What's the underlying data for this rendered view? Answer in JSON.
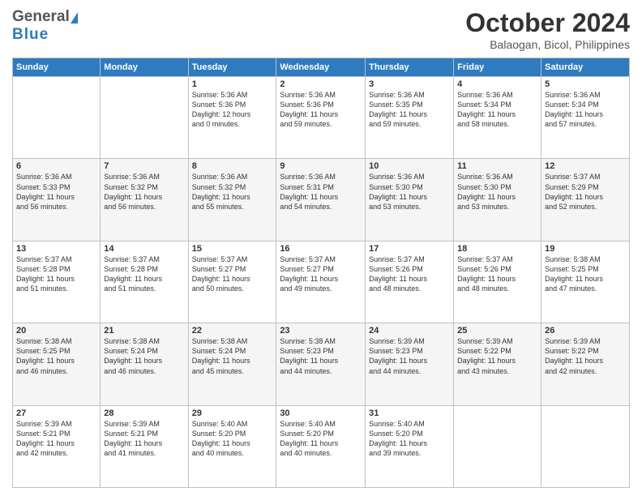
{
  "header": {
    "logo_general": "General",
    "logo_blue": "Blue",
    "month": "October 2024",
    "location": "Balaogan, Bicol, Philippines"
  },
  "days_of_week": [
    "Sunday",
    "Monday",
    "Tuesday",
    "Wednesday",
    "Thursday",
    "Friday",
    "Saturday"
  ],
  "weeks": [
    [
      {
        "day": "",
        "info": ""
      },
      {
        "day": "",
        "info": ""
      },
      {
        "day": "1",
        "info": "Sunrise: 5:36 AM\nSunset: 5:36 PM\nDaylight: 12 hours\nand 0 minutes."
      },
      {
        "day": "2",
        "info": "Sunrise: 5:36 AM\nSunset: 5:36 PM\nDaylight: 11 hours\nand 59 minutes."
      },
      {
        "day": "3",
        "info": "Sunrise: 5:36 AM\nSunset: 5:35 PM\nDaylight: 11 hours\nand 59 minutes."
      },
      {
        "day": "4",
        "info": "Sunrise: 5:36 AM\nSunset: 5:34 PM\nDaylight: 11 hours\nand 58 minutes."
      },
      {
        "day": "5",
        "info": "Sunrise: 5:36 AM\nSunset: 5:34 PM\nDaylight: 11 hours\nand 57 minutes."
      }
    ],
    [
      {
        "day": "6",
        "info": "Sunrise: 5:36 AM\nSunset: 5:33 PM\nDaylight: 11 hours\nand 56 minutes."
      },
      {
        "day": "7",
        "info": "Sunrise: 5:36 AM\nSunset: 5:32 PM\nDaylight: 11 hours\nand 56 minutes."
      },
      {
        "day": "8",
        "info": "Sunrise: 5:36 AM\nSunset: 5:32 PM\nDaylight: 11 hours\nand 55 minutes."
      },
      {
        "day": "9",
        "info": "Sunrise: 5:36 AM\nSunset: 5:31 PM\nDaylight: 11 hours\nand 54 minutes."
      },
      {
        "day": "10",
        "info": "Sunrise: 5:36 AM\nSunset: 5:30 PM\nDaylight: 11 hours\nand 53 minutes."
      },
      {
        "day": "11",
        "info": "Sunrise: 5:36 AM\nSunset: 5:30 PM\nDaylight: 11 hours\nand 53 minutes."
      },
      {
        "day": "12",
        "info": "Sunrise: 5:37 AM\nSunset: 5:29 PM\nDaylight: 11 hours\nand 52 minutes."
      }
    ],
    [
      {
        "day": "13",
        "info": "Sunrise: 5:37 AM\nSunset: 5:28 PM\nDaylight: 11 hours\nand 51 minutes."
      },
      {
        "day": "14",
        "info": "Sunrise: 5:37 AM\nSunset: 5:28 PM\nDaylight: 11 hours\nand 51 minutes."
      },
      {
        "day": "15",
        "info": "Sunrise: 5:37 AM\nSunset: 5:27 PM\nDaylight: 11 hours\nand 50 minutes."
      },
      {
        "day": "16",
        "info": "Sunrise: 5:37 AM\nSunset: 5:27 PM\nDaylight: 11 hours\nand 49 minutes."
      },
      {
        "day": "17",
        "info": "Sunrise: 5:37 AM\nSunset: 5:26 PM\nDaylight: 11 hours\nand 48 minutes."
      },
      {
        "day": "18",
        "info": "Sunrise: 5:37 AM\nSunset: 5:26 PM\nDaylight: 11 hours\nand 48 minutes."
      },
      {
        "day": "19",
        "info": "Sunrise: 5:38 AM\nSunset: 5:25 PM\nDaylight: 11 hours\nand 47 minutes."
      }
    ],
    [
      {
        "day": "20",
        "info": "Sunrise: 5:38 AM\nSunset: 5:25 PM\nDaylight: 11 hours\nand 46 minutes."
      },
      {
        "day": "21",
        "info": "Sunrise: 5:38 AM\nSunset: 5:24 PM\nDaylight: 11 hours\nand 46 minutes."
      },
      {
        "day": "22",
        "info": "Sunrise: 5:38 AM\nSunset: 5:24 PM\nDaylight: 11 hours\nand 45 minutes."
      },
      {
        "day": "23",
        "info": "Sunrise: 5:38 AM\nSunset: 5:23 PM\nDaylight: 11 hours\nand 44 minutes."
      },
      {
        "day": "24",
        "info": "Sunrise: 5:39 AM\nSunset: 5:23 PM\nDaylight: 11 hours\nand 44 minutes."
      },
      {
        "day": "25",
        "info": "Sunrise: 5:39 AM\nSunset: 5:22 PM\nDaylight: 11 hours\nand 43 minutes."
      },
      {
        "day": "26",
        "info": "Sunrise: 5:39 AM\nSunset: 5:22 PM\nDaylight: 11 hours\nand 42 minutes."
      }
    ],
    [
      {
        "day": "27",
        "info": "Sunrise: 5:39 AM\nSunset: 5:21 PM\nDaylight: 11 hours\nand 42 minutes."
      },
      {
        "day": "28",
        "info": "Sunrise: 5:39 AM\nSunset: 5:21 PM\nDaylight: 11 hours\nand 41 minutes."
      },
      {
        "day": "29",
        "info": "Sunrise: 5:40 AM\nSunset: 5:20 PM\nDaylight: 11 hours\nand 40 minutes."
      },
      {
        "day": "30",
        "info": "Sunrise: 5:40 AM\nSunset: 5:20 PM\nDaylight: 11 hours\nand 40 minutes."
      },
      {
        "day": "31",
        "info": "Sunrise: 5:40 AM\nSunset: 5:20 PM\nDaylight: 11 hours\nand 39 minutes."
      },
      {
        "day": "",
        "info": ""
      },
      {
        "day": "",
        "info": ""
      }
    ]
  ]
}
